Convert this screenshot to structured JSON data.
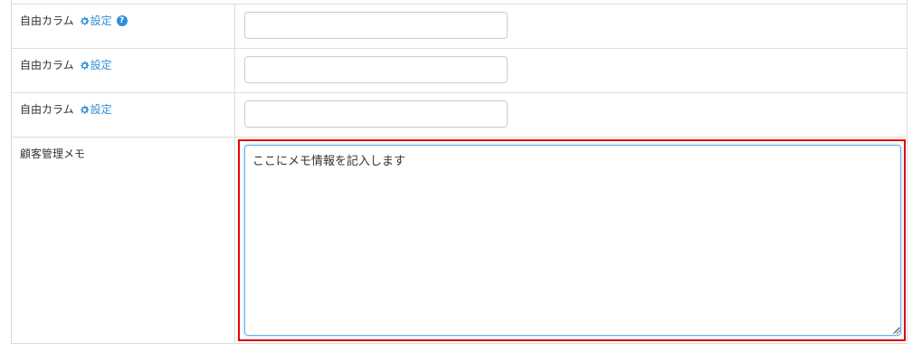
{
  "rows": [
    {
      "label": "自由カラム",
      "settings_label": "設定",
      "help": "?",
      "value": ""
    },
    {
      "label": "自由カラム",
      "settings_label": "設定",
      "value": ""
    },
    {
      "label": "自由カラム",
      "settings_label": "設定",
      "value": ""
    }
  ],
  "memo": {
    "label": "顧客管理メモ",
    "value": "ここにメモ情報を記入します",
    "highlighted": true
  },
  "colors": {
    "link": "#2f8fd8",
    "border": "#dddddd",
    "highlight": "#e00000",
    "focus": "#66afe9"
  },
  "icons": [
    "gear-icon",
    "help-icon"
  ]
}
